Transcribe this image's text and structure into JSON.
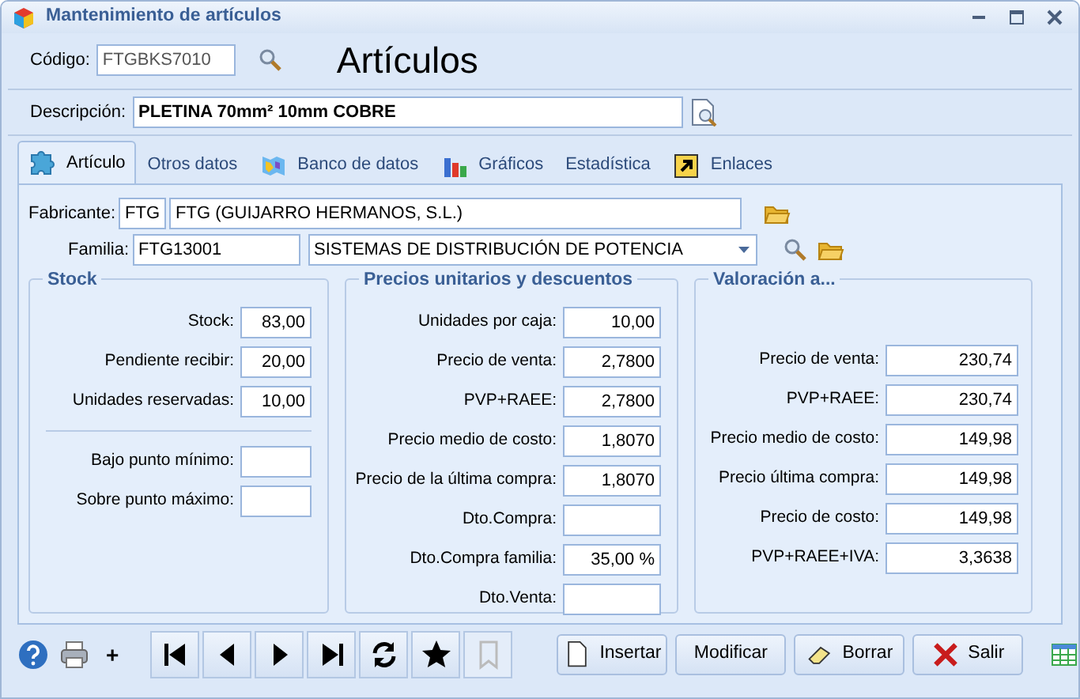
{
  "window": {
    "title": "Mantenimiento de artículos"
  },
  "header": {
    "title": "Artículos",
    "code": {
      "label": "Código:",
      "value": "FTGBKS7010"
    },
    "description": {
      "label": "Descripción:",
      "value": "PLETINA 70mm² 10mm COBRE"
    }
  },
  "tabs": [
    {
      "label": "Artículo",
      "selected": true,
      "kind": "puzzle"
    },
    {
      "label": "Otros datos",
      "selected": false,
      "kind": "plain"
    },
    {
      "label": "Banco de datos",
      "selected": false,
      "kind": "map"
    },
    {
      "label": "Gráficos",
      "selected": false,
      "kind": "chart"
    },
    {
      "label": "Estadística",
      "selected": false,
      "kind": "plain"
    },
    {
      "label": "Enlaces",
      "selected": false,
      "kind": "shortcut"
    }
  ],
  "manufacturer": {
    "label": "Fabricante:",
    "code": "FTG",
    "name": "FTG (GUIJARRO HERMANOS, S.L.)"
  },
  "family": {
    "label": "Familia:",
    "code": "FTG13001",
    "name": "SISTEMAS DE DISTRIBUCIÓN DE POTENCIA"
  },
  "stock": {
    "title": "Stock",
    "fields": [
      {
        "label": "Stock:",
        "value": "83,00"
      },
      {
        "label": "Pendiente recibir:",
        "value": "20,00"
      },
      {
        "label": "Unidades reservadas:",
        "value": "10,00"
      }
    ],
    "limits": [
      {
        "label": "Bajo punto mínimo:"
      },
      {
        "label": "Sobre punto máximo:"
      }
    ]
  },
  "prices": {
    "title": "Precios unitarios y descuentos",
    "fields": [
      {
        "label": "Unidades por caja:",
        "value": "10,00"
      },
      {
        "label": "Precio de venta:",
        "value": "2,7800"
      },
      {
        "label": "PVP+RAEE:",
        "value": "2,7800"
      },
      {
        "label": "Precio medio de costo:",
        "value": "1,8070"
      },
      {
        "label": "Precio de la última compra:",
        "value": "1,8070"
      },
      {
        "label": "Dto.Compra:"
      },
      {
        "label": "Dto.Compra familia:",
        "value": "35,00 %"
      },
      {
        "label": "Dto.Venta:"
      }
    ]
  },
  "valuation": {
    "title": "Valoración a...",
    "fields": [
      {
        "label": "Precio de venta:",
        "value": "230,74"
      },
      {
        "label": "PVP+RAEE:",
        "value": "230,74"
      },
      {
        "label": "Precio medio de costo:",
        "value": "149,98"
      },
      {
        "label": "Precio última compra:",
        "value": "149,98"
      },
      {
        "label": "Precio de costo:",
        "value": "149,98"
      },
      {
        "label": "PVP+RAEE+IVA:",
        "value": "3,3638"
      }
    ]
  },
  "toolbar": {
    "add": "+",
    "nav": [
      {
        "kind": "first",
        "disabled": false
      },
      {
        "kind": "prev",
        "disabled": false
      },
      {
        "kind": "next",
        "disabled": false
      },
      {
        "kind": "last",
        "disabled": false
      },
      {
        "kind": "refresh",
        "disabled": false
      },
      {
        "kind": "star",
        "disabled": false
      },
      {
        "kind": "bookmark",
        "disabled": true
      }
    ],
    "actions": [
      {
        "label": "Insertar",
        "kind": "new"
      },
      {
        "label": "Modificar",
        "kind": "plain"
      },
      {
        "label": "Borrar",
        "kind": "erase"
      },
      {
        "label": "Salir",
        "kind": "exit"
      }
    ]
  }
}
